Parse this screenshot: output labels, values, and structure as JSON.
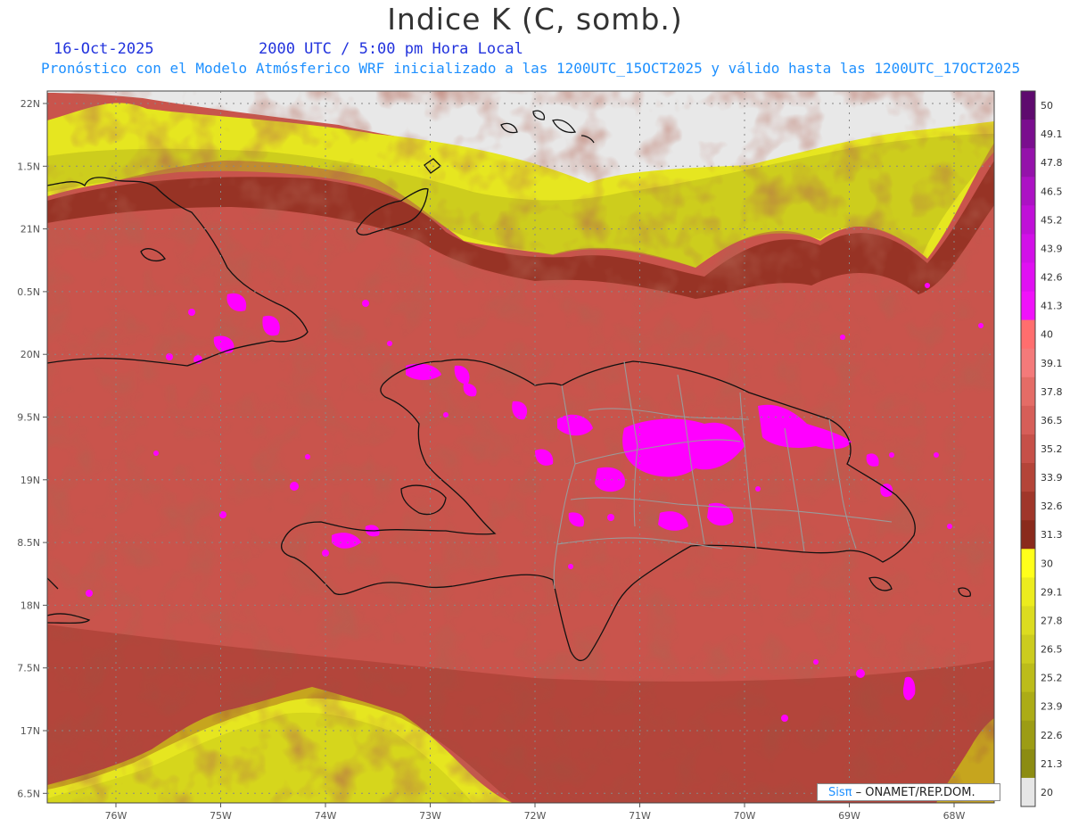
{
  "header": {
    "title": "Indice K (C, somb.)",
    "date": "16-Oct-2025",
    "time": "2000 UTC / 5:00 pm Hora Local",
    "forecast": "Pronóstico con el Modelo Atmósferico WRF inicializado a las 1200UTC_15OCT2025 y válido hasta las  1200UTC_17OCT2025"
  },
  "lat_labels": [
    "22N",
    "1.5N",
    "21N",
    "0.5N",
    "20N",
    "9.5N",
    "19N",
    "8.5N",
    "18N",
    "7.5N",
    "17N",
    "6.5N"
  ],
  "lon_labels": [
    "76W",
    "75W",
    "74W",
    "73W",
    "72W",
    "71W",
    "70W",
    "69W",
    "68W"
  ],
  "colorbar": {
    "labels": [
      "50",
      "49.1",
      "47.8",
      "46.5",
      "45.2",
      "43.9",
      "42.6",
      "41.3",
      "40",
      "39.1",
      "37.8",
      "36.5",
      "35.2",
      "33.9",
      "32.6",
      "31.3",
      "30",
      "29.1",
      "27.8",
      "26.5",
      "25.2",
      "23.9",
      "22.6",
      "21.3",
      "20"
    ],
    "colors": [
      "#5e0a6e",
      "#7a0e8e",
      "#9412aa",
      "#ac12c4",
      "#c010d8",
      "#d210e8",
      "#e010f2",
      "#f012fa",
      "#ff6e6e",
      "#f47a7a",
      "#e46c66",
      "#d65e58",
      "#c65048",
      "#b44438",
      "#a0362a",
      "#8a2a1c",
      "#ffff1a",
      "#ecec1e",
      "#dcdc20",
      "#cccc1e",
      "#bcbc1a",
      "#acac16",
      "#9c9c14",
      "#8c8c12",
      "#e6e6e6"
    ]
  },
  "credit": {
    "brand": "Sisπ",
    "text": " – ONAMET/REP.DOM."
  }
}
